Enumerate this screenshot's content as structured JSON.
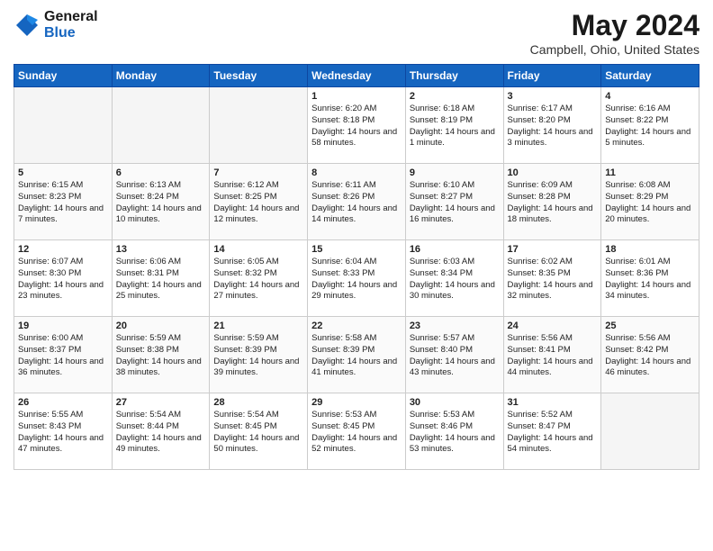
{
  "header": {
    "logo_general": "General",
    "logo_blue": "Blue",
    "month_title": "May 2024",
    "location": "Campbell, Ohio, United States"
  },
  "days_of_week": [
    "Sunday",
    "Monday",
    "Tuesday",
    "Wednesday",
    "Thursday",
    "Friday",
    "Saturday"
  ],
  "weeks": [
    [
      {
        "day": "",
        "empty": true
      },
      {
        "day": "",
        "empty": true
      },
      {
        "day": "",
        "empty": true
      },
      {
        "day": "1",
        "sunrise": "Sunrise: 6:20 AM",
        "sunset": "Sunset: 8:18 PM",
        "daylight": "Daylight: 14 hours and 58 minutes."
      },
      {
        "day": "2",
        "sunrise": "Sunrise: 6:18 AM",
        "sunset": "Sunset: 8:19 PM",
        "daylight": "Daylight: 14 hours and 1 minute."
      },
      {
        "day": "3",
        "sunrise": "Sunrise: 6:17 AM",
        "sunset": "Sunset: 8:20 PM",
        "daylight": "Daylight: 14 hours and 3 minutes."
      },
      {
        "day": "4",
        "sunrise": "Sunrise: 6:16 AM",
        "sunset": "Sunset: 8:22 PM",
        "daylight": "Daylight: 14 hours and 5 minutes."
      }
    ],
    [
      {
        "day": "5",
        "sunrise": "Sunrise: 6:15 AM",
        "sunset": "Sunset: 8:23 PM",
        "daylight": "Daylight: 14 hours and 7 minutes."
      },
      {
        "day": "6",
        "sunrise": "Sunrise: 6:13 AM",
        "sunset": "Sunset: 8:24 PM",
        "daylight": "Daylight: 14 hours and 10 minutes."
      },
      {
        "day": "7",
        "sunrise": "Sunrise: 6:12 AM",
        "sunset": "Sunset: 8:25 PM",
        "daylight": "Daylight: 14 hours and 12 minutes."
      },
      {
        "day": "8",
        "sunrise": "Sunrise: 6:11 AM",
        "sunset": "Sunset: 8:26 PM",
        "daylight": "Daylight: 14 hours and 14 minutes."
      },
      {
        "day": "9",
        "sunrise": "Sunrise: 6:10 AM",
        "sunset": "Sunset: 8:27 PM",
        "daylight": "Daylight: 14 hours and 16 minutes."
      },
      {
        "day": "10",
        "sunrise": "Sunrise: 6:09 AM",
        "sunset": "Sunset: 8:28 PM",
        "daylight": "Daylight: 14 hours and 18 minutes."
      },
      {
        "day": "11",
        "sunrise": "Sunrise: 6:08 AM",
        "sunset": "Sunset: 8:29 PM",
        "daylight": "Daylight: 14 hours and 20 minutes."
      }
    ],
    [
      {
        "day": "12",
        "sunrise": "Sunrise: 6:07 AM",
        "sunset": "Sunset: 8:30 PM",
        "daylight": "Daylight: 14 hours and 23 minutes."
      },
      {
        "day": "13",
        "sunrise": "Sunrise: 6:06 AM",
        "sunset": "Sunset: 8:31 PM",
        "daylight": "Daylight: 14 hours and 25 minutes."
      },
      {
        "day": "14",
        "sunrise": "Sunrise: 6:05 AM",
        "sunset": "Sunset: 8:32 PM",
        "daylight": "Daylight: 14 hours and 27 minutes."
      },
      {
        "day": "15",
        "sunrise": "Sunrise: 6:04 AM",
        "sunset": "Sunset: 8:33 PM",
        "daylight": "Daylight: 14 hours and 29 minutes."
      },
      {
        "day": "16",
        "sunrise": "Sunrise: 6:03 AM",
        "sunset": "Sunset: 8:34 PM",
        "daylight": "Daylight: 14 hours and 30 minutes."
      },
      {
        "day": "17",
        "sunrise": "Sunrise: 6:02 AM",
        "sunset": "Sunset: 8:35 PM",
        "daylight": "Daylight: 14 hours and 32 minutes."
      },
      {
        "day": "18",
        "sunrise": "Sunrise: 6:01 AM",
        "sunset": "Sunset: 8:36 PM",
        "daylight": "Daylight: 14 hours and 34 minutes."
      }
    ],
    [
      {
        "day": "19",
        "sunrise": "Sunrise: 6:00 AM",
        "sunset": "Sunset: 8:37 PM",
        "daylight": "Daylight: 14 hours and 36 minutes."
      },
      {
        "day": "20",
        "sunrise": "Sunrise: 5:59 AM",
        "sunset": "Sunset: 8:38 PM",
        "daylight": "Daylight: 14 hours and 38 minutes."
      },
      {
        "day": "21",
        "sunrise": "Sunrise: 5:59 AM",
        "sunset": "Sunset: 8:39 PM",
        "daylight": "Daylight: 14 hours and 39 minutes."
      },
      {
        "day": "22",
        "sunrise": "Sunrise: 5:58 AM",
        "sunset": "Sunset: 8:39 PM",
        "daylight": "Daylight: 14 hours and 41 minutes."
      },
      {
        "day": "23",
        "sunrise": "Sunrise: 5:57 AM",
        "sunset": "Sunset: 8:40 PM",
        "daylight": "Daylight: 14 hours and 43 minutes."
      },
      {
        "day": "24",
        "sunrise": "Sunrise: 5:56 AM",
        "sunset": "Sunset: 8:41 PM",
        "daylight": "Daylight: 14 hours and 44 minutes."
      },
      {
        "day": "25",
        "sunrise": "Sunrise: 5:56 AM",
        "sunset": "Sunset: 8:42 PM",
        "daylight": "Daylight: 14 hours and 46 minutes."
      }
    ],
    [
      {
        "day": "26",
        "sunrise": "Sunrise: 5:55 AM",
        "sunset": "Sunset: 8:43 PM",
        "daylight": "Daylight: 14 hours and 47 minutes."
      },
      {
        "day": "27",
        "sunrise": "Sunrise: 5:54 AM",
        "sunset": "Sunset: 8:44 PM",
        "daylight": "Daylight: 14 hours and 49 minutes."
      },
      {
        "day": "28",
        "sunrise": "Sunrise: 5:54 AM",
        "sunset": "Sunset: 8:45 PM",
        "daylight": "Daylight: 14 hours and 50 minutes."
      },
      {
        "day": "29",
        "sunrise": "Sunrise: 5:53 AM",
        "sunset": "Sunset: 8:45 PM",
        "daylight": "Daylight: 14 hours and 52 minutes."
      },
      {
        "day": "30",
        "sunrise": "Sunrise: 5:53 AM",
        "sunset": "Sunset: 8:46 PM",
        "daylight": "Daylight: 14 hours and 53 minutes."
      },
      {
        "day": "31",
        "sunrise": "Sunrise: 5:52 AM",
        "sunset": "Sunset: 8:47 PM",
        "daylight": "Daylight: 14 hours and 54 minutes."
      },
      {
        "day": "",
        "empty": true
      }
    ]
  ]
}
